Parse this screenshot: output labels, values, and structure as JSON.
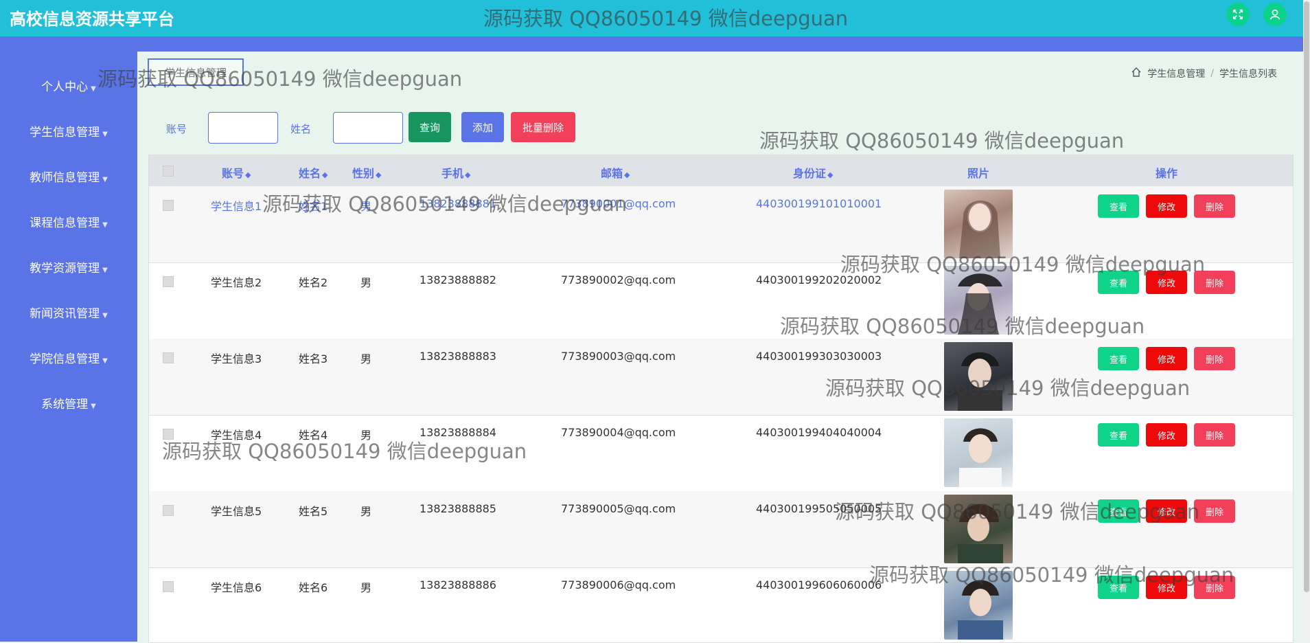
{
  "app": {
    "title": "高校信息资源共享平台"
  },
  "header_icons": [
    "fullscreen-icon",
    "user-icon"
  ],
  "sidebar": {
    "items": [
      {
        "label": "个人中心"
      },
      {
        "label": "学生信息管理"
      },
      {
        "label": "教师信息管理"
      },
      {
        "label": "课程信息管理"
      },
      {
        "label": "教学资源管理"
      },
      {
        "label": "新闻资讯管理"
      },
      {
        "label": "学院信息管理"
      },
      {
        "label": "系统管理"
      }
    ]
  },
  "page_tab": {
    "label": "学生信息管理"
  },
  "breadcrumb": {
    "items": [
      "学生信息管理",
      "学生信息列表"
    ]
  },
  "search": {
    "account_label": "账号",
    "name_label": "姓名",
    "account_value": "",
    "name_value": "",
    "query_btn": "查询",
    "add_btn": "添加",
    "batch_delete_btn": "批量删除"
  },
  "table": {
    "headers": [
      "账号",
      "姓名",
      "性别",
      "手机",
      "邮箱",
      "身份证",
      "照片",
      "操作"
    ],
    "actions": {
      "view": "查看",
      "edit": "修改",
      "delete": "删除"
    },
    "rows": [
      {
        "account": "学生信息1",
        "name": "姓名1",
        "gender": "男",
        "phone": "13823888881",
        "email": "773890001@qq.com",
        "id_card": "440300199101010001"
      },
      {
        "account": "学生信息2",
        "name": "姓名2",
        "gender": "男",
        "phone": "13823888882",
        "email": "773890002@qq.com",
        "id_card": "440300199202020002"
      },
      {
        "account": "学生信息3",
        "name": "姓名3",
        "gender": "男",
        "phone": "13823888883",
        "email": "773890003@qq.com",
        "id_card": "440300199303030003"
      },
      {
        "account": "学生信息4",
        "name": "姓名4",
        "gender": "男",
        "phone": "13823888884",
        "email": "773890004@qq.com",
        "id_card": "440300199404040004"
      },
      {
        "account": "学生信息5",
        "name": "姓名5",
        "gender": "男",
        "phone": "13823888885",
        "email": "773890005@qq.com",
        "id_card": "440300199505050005"
      },
      {
        "account": "学生信息6",
        "name": "姓名6",
        "gender": "男",
        "phone": "13823888886",
        "email": "773890006@qq.com",
        "id_card": "440300199606060006"
      }
    ]
  },
  "watermark": {
    "text": "源码获取 QQ86050149 微信deepguan"
  },
  "colors": {
    "header": "#22bfd8",
    "sidebar": "#5a73e6",
    "view_btn": "#10d38a",
    "edit_btn": "#ee0a0a",
    "delete_btn": "#f3405a",
    "query_btn": "#16955e",
    "add_btn": "#5a73e6",
    "batch_btn": "#f3405a"
  }
}
